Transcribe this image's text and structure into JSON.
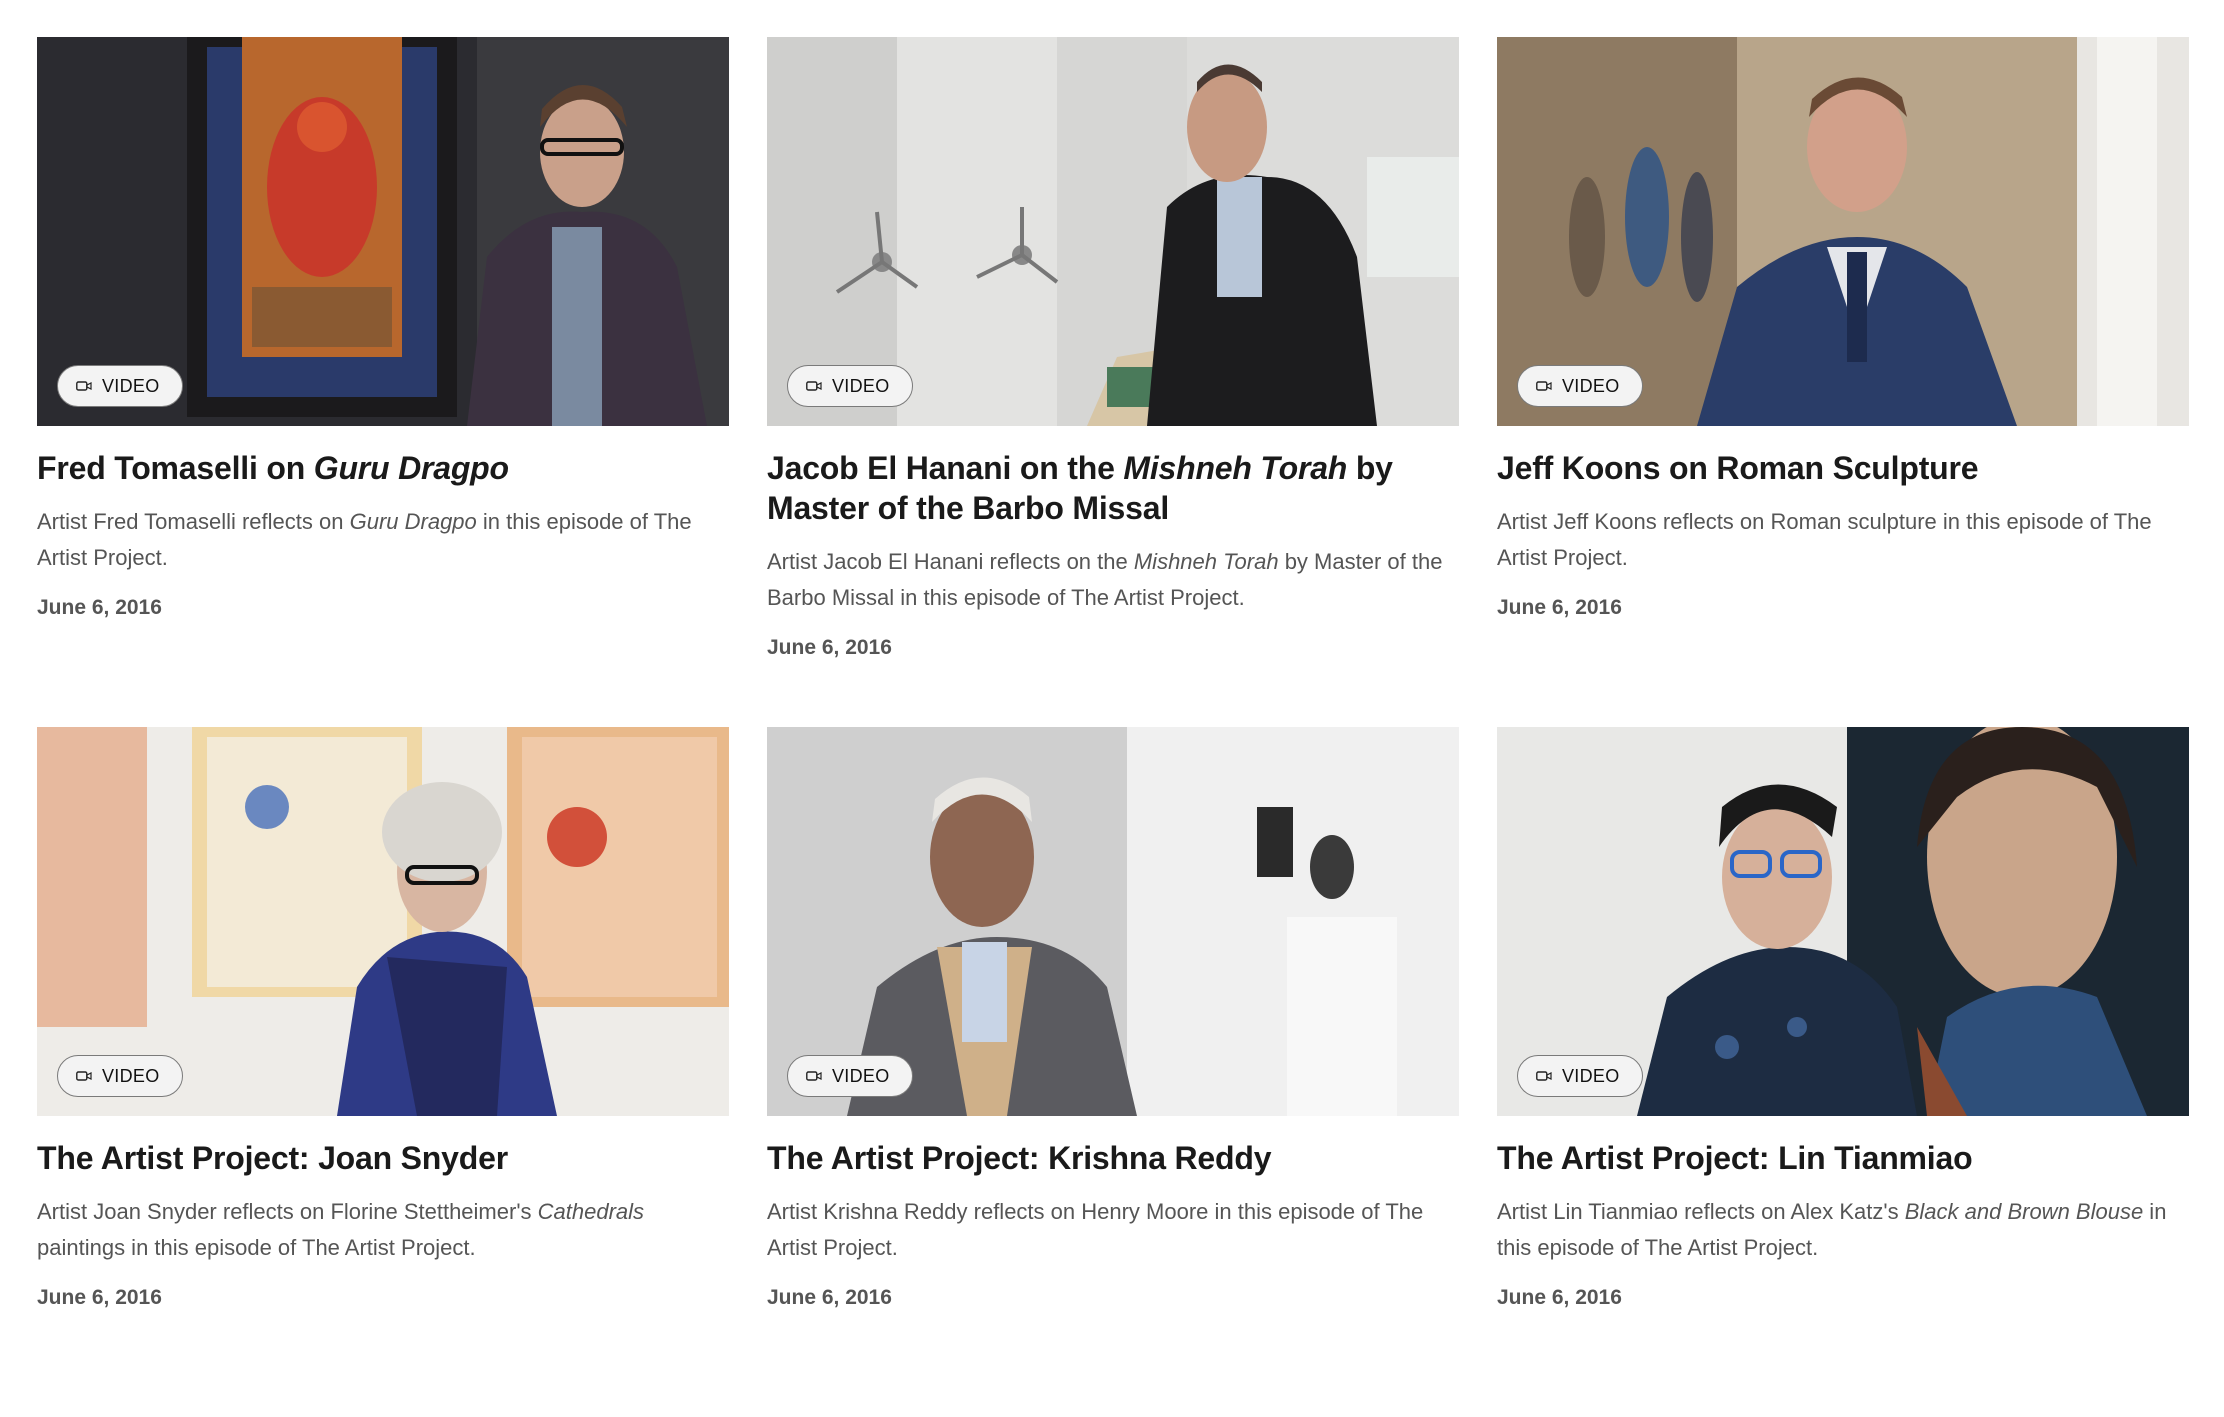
{
  "cards": [
    {
      "badge": "VIDEO",
      "title_pre": "Fred Tomaselli on ",
      "title_em": "Guru Dragpo",
      "title_post": "",
      "desc_pre": "Artist Fred Tomaselli reflects on ",
      "desc_em": "Guru Dragpo",
      "desc_post": " in this episode of The Artist Project.",
      "date": "June 6, 2016"
    },
    {
      "badge": "VIDEO",
      "title_pre": "Jacob El Hanani on the ",
      "title_em": "Mishneh Torah",
      "title_post": " by Master of the Barbo Missal",
      "desc_pre": "Artist Jacob El Hanani reflects on the ",
      "desc_em": "Mishneh Torah",
      "desc_post": " by Master of the Barbo Missal in this episode of The Artist Project.",
      "date": "June 6, 2016"
    },
    {
      "badge": "VIDEO",
      "title_pre": "Jeff Koons on Roman Sculpture",
      "title_em": "",
      "title_post": "",
      "desc_pre": "Artist Jeff Koons reflects on Roman sculpture in this episode of The Artist Project.",
      "desc_em": "",
      "desc_post": "",
      "date": "June 6, 2016"
    },
    {
      "badge": "VIDEO",
      "title_pre": "The Artist Project: Joan Snyder",
      "title_em": "",
      "title_post": "",
      "desc_pre": "Artist Joan Snyder reflects on Florine Stettheimer's ",
      "desc_em": "Cathedrals",
      "desc_post": " paintings in this episode of The Artist Project.",
      "date": "June 6, 2016"
    },
    {
      "badge": "VIDEO",
      "title_pre": "The Artist Project: Krishna Reddy",
      "title_em": "",
      "title_post": "",
      "desc_pre": "Artist Krishna Reddy reflects on Henry Moore in this episode of The Artist Project.",
      "desc_em": "",
      "desc_post": "",
      "date": "June 6, 2016"
    },
    {
      "badge": "VIDEO",
      "title_pre": "The Artist Project: Lin Tianmiao",
      "title_em": "",
      "title_post": "",
      "desc_pre": "Artist Lin Tianmiao reflects on Alex Katz's ",
      "desc_em": "Black and Brown Blouse",
      "desc_post": " in this episode of The Artist Project.",
      "date": "June 6, 2016"
    }
  ],
  "icons": {
    "badge_icon": "video-camera-icon"
  },
  "colors": {
    "title": "#1a1a1a",
    "body": "#555555",
    "badge_bg": "#f3f3f3"
  }
}
